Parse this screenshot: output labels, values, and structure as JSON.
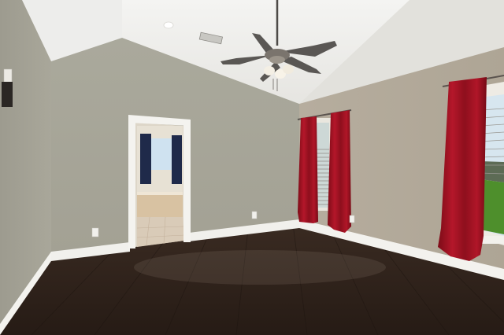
{
  "scene": {
    "subject": "empty-bedroom",
    "colors": {
      "wall": "#a7a597",
      "wall_right": "#b2aa9c",
      "ceiling": "#ececea",
      "floor": "#2f231c",
      "baseboard": "#f3f2ee",
      "curtain": "#a3101f",
      "fan": "#555250",
      "bath_tile": "#d9cbb8",
      "window_sky": "#cfe2f0",
      "lawn": "#4e8f2c"
    },
    "fixtures": {
      "ceiling_fan_blades": 5,
      "windows": 3,
      "curtain_panels": 3,
      "outlets": 3
    }
  }
}
